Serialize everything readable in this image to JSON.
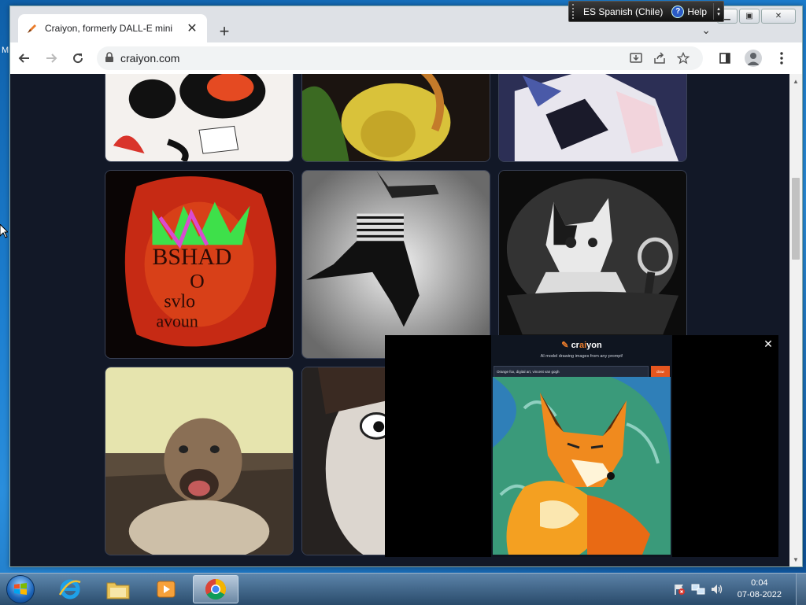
{
  "language_bar": {
    "language": "ES Spanish (Chile)",
    "help_label": "Help"
  },
  "browser": {
    "tab": {
      "title": "Craiyon, formerly DALL-E mini"
    },
    "url": "craiyon.com"
  },
  "page": {
    "gallery_alt": [
      "dog cartoon",
      "yellow figure",
      "blue cartoon",
      "graffiti text",
      "falling person",
      "cat with spoon",
      "dog on field",
      "cartoon face"
    ]
  },
  "pip": {
    "brand_prefix": "cr",
    "brand_accent": "ai",
    "brand_suffix": "yon",
    "tagline": "AI model drawing images from any prompt!",
    "prompt": "Orange fox, digital art, vincent van gogh",
    "button": "draw"
  },
  "desktop": {
    "edge_letter": "M"
  },
  "taskbar": {
    "time": "0:04",
    "date": "07-08-2022"
  },
  "colors": {
    "accent": "#ea7c2b",
    "page_bg": "#121827",
    "draw_button": "#e5561f"
  }
}
